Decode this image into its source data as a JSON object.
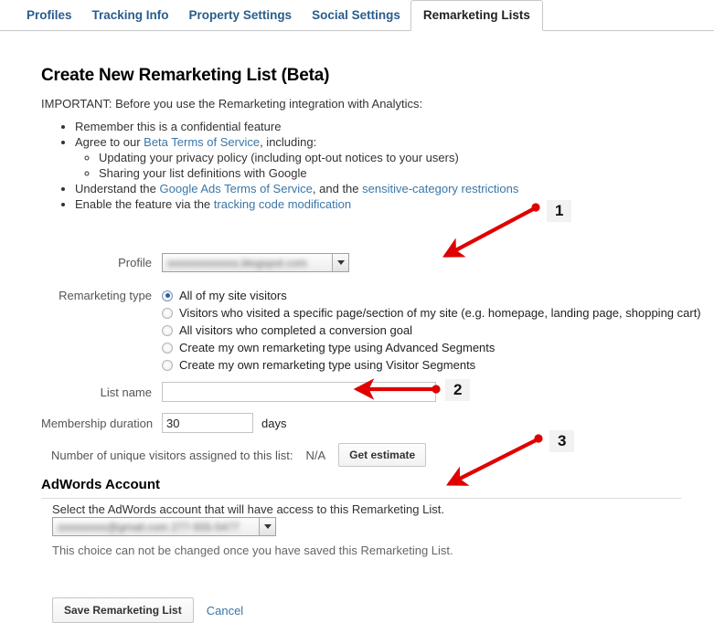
{
  "tabs": [
    {
      "label": "Profiles",
      "active": false
    },
    {
      "label": "Tracking Info",
      "active": false
    },
    {
      "label": "Property Settings",
      "active": false
    },
    {
      "label": "Social Settings",
      "active": false
    },
    {
      "label": "Remarketing Lists",
      "active": true
    }
  ],
  "page": {
    "title": "Create New Remarketing List (Beta)",
    "important": "IMPORTANT: Before you use the Remarketing integration with Analytics:"
  },
  "bullets": {
    "b1": "Remember this is a confidential feature",
    "b2_pre": "Agree to our ",
    "b2_link": "Beta Terms of Service",
    "b2_post": ", including:",
    "b2_sub1": "Updating your privacy policy (including opt-out notices to your users)",
    "b2_sub2": "Sharing your list definitions with Google",
    "b3_pre": "Understand the ",
    "b3_link1": "Google Ads Terms of Service",
    "b3_mid": ", and the ",
    "b3_link2": "sensitive-category restrictions",
    "b4_pre": "Enable the feature via the ",
    "b4_link": "tracking code modification"
  },
  "form": {
    "profile_label": "Profile",
    "profile_value": "xxxxxxxxxxxxx.blogspot.com",
    "remarketing_type_label": "Remarketing type",
    "remarketing_options": [
      {
        "label": "All of my site visitors",
        "checked": true
      },
      {
        "label": "Visitors who visited a specific page/section of my site (e.g. homepage, landing page, shopping cart)",
        "checked": false
      },
      {
        "label": "All visitors who completed a conversion goal",
        "checked": false
      },
      {
        "label": "Create my own remarketing type using Advanced Segments",
        "checked": false
      },
      {
        "label": "Create my own remarketing type using Visitor Segments",
        "checked": false
      }
    ],
    "list_name_label": "List name",
    "list_name_value": "",
    "list_name_placeholder": "",
    "membership_label": "Membership duration",
    "membership_value": "30",
    "membership_units": "days",
    "estimate_label": "Number of unique visitors assigned to this list:",
    "estimate_value": "N/A",
    "estimate_button": "Get estimate"
  },
  "adwords": {
    "heading": "AdWords Account",
    "description": "Select the AdWords account that will have access to this Remarketing List.",
    "account_value": "xxxxxxxxx@gmail.com  277-555-5477",
    "note": "This choice can not be changed once you have saved this Remarketing List."
  },
  "actions": {
    "save_label": "Save Remarketing List",
    "cancel_label": "Cancel"
  },
  "annotations": {
    "color": "#e00000",
    "markers": [
      {
        "number": "1"
      },
      {
        "number": "2"
      },
      {
        "number": "3"
      }
    ]
  },
  "colors": {
    "link": "#3a76a8",
    "tab_active_text": "#222222",
    "tab_text": "#2a5d8c",
    "annotation_red": "#e00000"
  }
}
